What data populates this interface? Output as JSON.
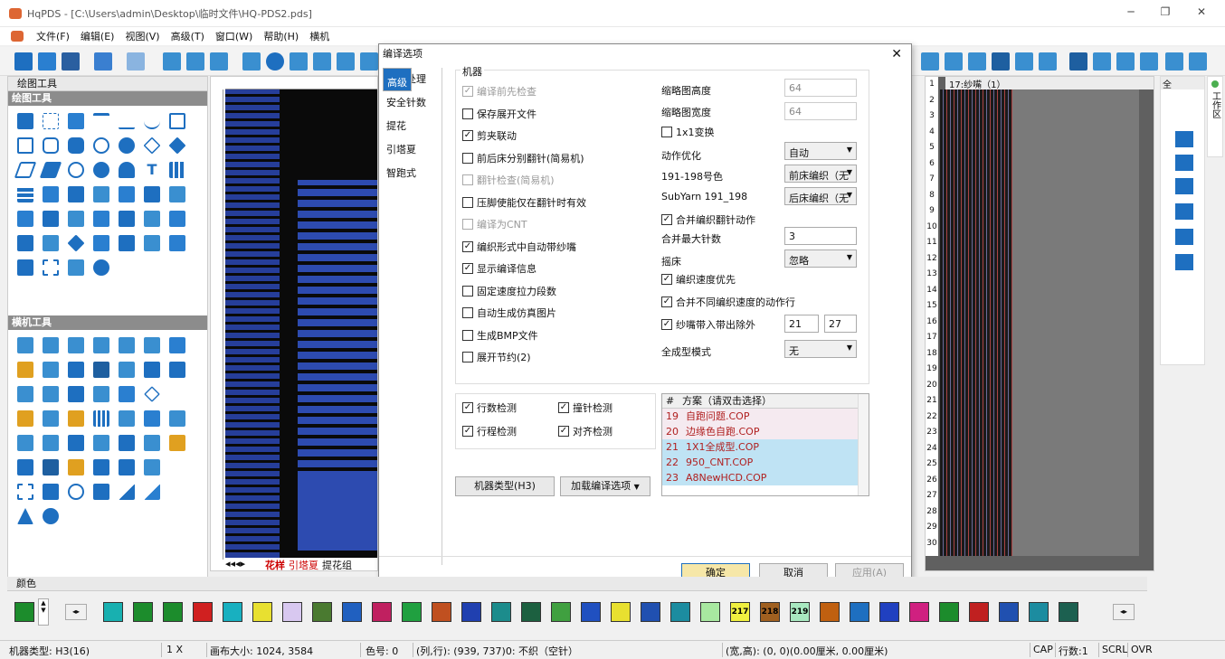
{
  "window": {
    "title": "HqPDS - [C:\\Users\\admin\\Desktop\\临时文件\\HQ-PDS2.pds]"
  },
  "menu": [
    "文件(F)",
    "编辑(E)",
    "视图(V)",
    "高级(T)",
    "窗口(W)",
    "帮助(H)",
    "横机"
  ],
  "left_panel": {
    "header": "绘图工具",
    "section1": "绘图工具",
    "section2": "横机工具"
  },
  "canvas_tabs": [
    "花样",
    "引塔夏",
    "提花组"
  ],
  "right_panel": {
    "header": "17:纱嘴（1）",
    "toolstrip_header": "全",
    "vertical_tab": "工作区"
  },
  "row_numbers": [
    "1",
    "2",
    "3",
    "4",
    "5",
    "6",
    "7",
    "8",
    "9",
    "10",
    "11",
    "12",
    "13",
    "14",
    "15",
    "16",
    "17",
    "18",
    "19",
    "20",
    "21",
    "22",
    "23",
    "24",
    "25",
    "26",
    "27",
    "28",
    "29",
    "30"
  ],
  "dialog": {
    "title": "编译选项",
    "nav": [
      "高级",
      "自动处理",
      "安全针数",
      "提花",
      "引塔夏",
      "智跑式"
    ],
    "group_label": "机器",
    "checks_left": [
      {
        "label": "编译前先检查",
        "checked": true,
        "disabled": true
      },
      {
        "label": "保存展开文件",
        "checked": false,
        "disabled": false
      },
      {
        "label": "剪夹联动",
        "checked": true,
        "disabled": false
      },
      {
        "label": "前后床分别翻针(简易机)",
        "checked": false,
        "disabled": false
      },
      {
        "label": "翻针检查(简易机)",
        "checked": false,
        "disabled": true
      },
      {
        "label": "压脚使能仅在翻针时有效",
        "checked": false,
        "disabled": false
      },
      {
        "label": "编译为CNT",
        "checked": false,
        "disabled": true
      },
      {
        "label": "编织形式中自动带纱嘴",
        "checked": true,
        "disabled": false
      },
      {
        "label": "显示编译信息",
        "checked": true,
        "disabled": false
      },
      {
        "label": "固定速度拉力段数",
        "checked": false,
        "disabled": false
      },
      {
        "label": "自动生成仿真图片",
        "checked": false,
        "disabled": false
      },
      {
        "label": "生成BMP文件",
        "checked": false,
        "disabled": false
      },
      {
        "label": "展开节约(2)",
        "checked": false,
        "disabled": false
      }
    ],
    "thumb_height_label": "缩略图高度",
    "thumb_height": "64",
    "thumb_width_label": "缩略图宽度",
    "thumb_width": "64",
    "swap_1x1": "1x1变换",
    "action_opt_label": "动作优化",
    "action_opt": "自动",
    "color_191_label": "191-198号色",
    "color_191": "前床编织（无",
    "subyarn_label": "SubYarn 191_198",
    "subyarn": "后床编织（无",
    "merge_flip": "合并编织翻针动作",
    "merge_max_label": "合并最大针数",
    "merge_max": "3",
    "rack_label": "摇床",
    "rack": "忽略",
    "speed_first": "编织速度优先",
    "merge_diff_speed": "合并不同编织速度的动作行",
    "yarn_carrier_label": "纱嘴带入带出除外",
    "yc_a": "21",
    "yc_b": "27",
    "full_form_label": "全成型模式",
    "full_form": "无",
    "detect": [
      {
        "label": "行数检测",
        "checked": true
      },
      {
        "label": "撞针检测",
        "checked": true
      },
      {
        "label": "行程检测",
        "checked": true
      },
      {
        "label": "对齐检测",
        "checked": true
      }
    ],
    "scheme_header": {
      "num": "#",
      "name": "方案（请双击选择）"
    },
    "schemes": [
      {
        "n": "19",
        "name": "自跑问题.COP"
      },
      {
        "n": "20",
        "name": "边缘色自跑.COP"
      },
      {
        "n": "21",
        "name": "1X1全成型.COP"
      },
      {
        "n": "22",
        "name": "950_CNT.COP"
      },
      {
        "n": "23",
        "name": "A8NewHCD.COP"
      }
    ],
    "machine_type_btn": "机器类型(H3)",
    "load_opts_btn": "加载编译选项",
    "ok": "确定",
    "cancel": "取消",
    "apply": "应用(A)"
  },
  "color_panel": {
    "header": "颜色",
    "labels": [
      "217",
      "218",
      "219"
    ]
  },
  "status": {
    "machine": "机器类型: H3(16)",
    "zoom": "1 X",
    "canvas_size": "画布大小: 1024, 3584",
    "color_no": "色号: 0",
    "pos": "(列,行): (939, 737)0: 不织（空针）",
    "size": "(宽,高): (0, 0)(0.00厘米, 0.00厘米)",
    "cap": "CAP",
    "rows": "行数:1",
    "scrl": "SCRL",
    "ovr": "OVR"
  }
}
